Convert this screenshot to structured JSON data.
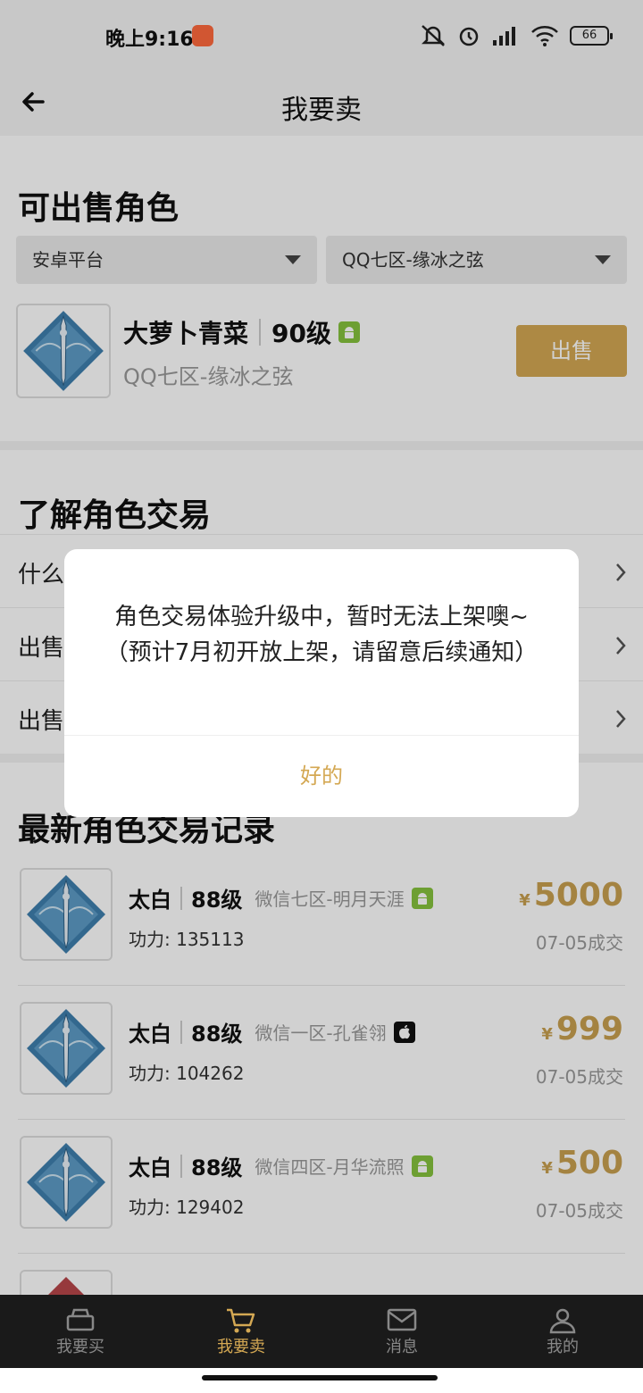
{
  "status_bar": {
    "time": "晚上9:16",
    "battery": "66"
  },
  "header": {
    "title": "我要卖"
  },
  "sell_section": {
    "title": "可出售角色",
    "platform_select": "安卓平台",
    "server_select": "QQ七区-缘冰之弦",
    "role": {
      "name": "大萝卜青菜",
      "level": "90级",
      "server": "QQ七区-缘冰之弦",
      "platform_icon": "android-icon"
    },
    "sell_button": "出售"
  },
  "learn_section": {
    "title": "了解角色交易",
    "items": [
      {
        "label": "什么"
      },
      {
        "label": "出售"
      },
      {
        "label": "出售"
      }
    ]
  },
  "records_section": {
    "title": "最新角色交易记录",
    "records": [
      {
        "name": "太白",
        "level": "88级",
        "server": "微信七区-明月天涯",
        "platform_icon": "android-icon",
        "power": "功力: 135113",
        "currency": "¥",
        "price": "5000",
        "date": "07-05成交"
      },
      {
        "name": "太白",
        "level": "88级",
        "server": "微信一区-孔雀翎",
        "platform_icon": "apple-icon",
        "power": "功力: 104262",
        "currency": "¥",
        "price": "999",
        "date": "07-05成交"
      },
      {
        "name": "太白",
        "level": "88级",
        "server": "微信四区-月华流照",
        "platform_icon": "android-icon",
        "power": "功力: 129402",
        "currency": "¥",
        "price": "500",
        "date": "07-05成交"
      }
    ]
  },
  "tabs": [
    {
      "label": "我要买",
      "icon": "shop-icon",
      "active": false
    },
    {
      "label": "我要卖",
      "icon": "cart-icon",
      "active": true
    },
    {
      "label": "消息",
      "icon": "mail-icon",
      "active": false
    },
    {
      "label": "我的",
      "icon": "user-icon",
      "active": false
    }
  ],
  "dialog": {
    "message": "角色交易体验升级中，暂时无法上架噢~（预计7月初开放上架，请留意后续通知）",
    "ok_button": "好的"
  },
  "colors": {
    "accent": "#d4a853",
    "price": "#c9a050",
    "android": "#86c23d",
    "tabbar": "#1a1a1a"
  }
}
